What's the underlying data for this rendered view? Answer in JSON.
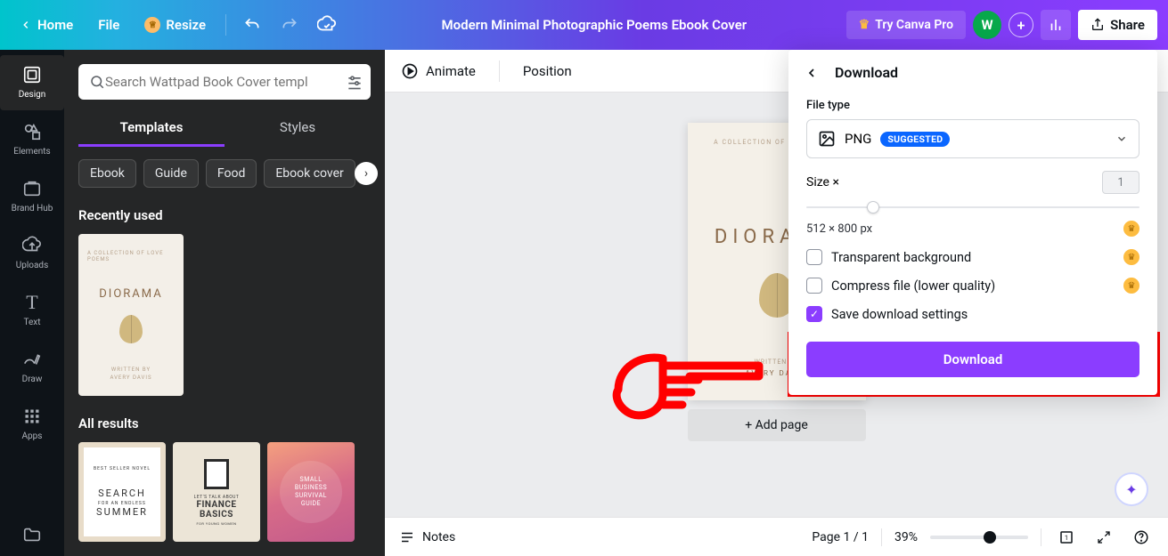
{
  "topbar": {
    "home": "Home",
    "file": "File",
    "resize": "Resize",
    "title": "Modern Minimal Photographic Poems Ebook Cover",
    "try_pro": "Try Canva Pro",
    "avatar_letter": "W",
    "share": "Share"
  },
  "rail": {
    "design": "Design",
    "elements": "Elements",
    "brandhub": "Brand Hub",
    "uploads": "Uploads",
    "text": "Text",
    "draw": "Draw",
    "apps": "Apps"
  },
  "panel": {
    "search_placeholder": "Search Wattpad Book Cover templ",
    "tab_templates": "Templates",
    "tab_styles": "Styles",
    "chips": {
      "ebook": "Ebook",
      "guide": "Guide",
      "food": "Food",
      "ebook_cover": "Ebook cover"
    },
    "recently_used": "Recently used",
    "all_results": "All results",
    "template1": {
      "top": "A COLLECTION OF LOVE POEMS",
      "title": "DIORAMA",
      "written": "WRITTEN BY",
      "author": "AVERY DAVIS"
    },
    "template_sm1": {
      "l1": "BEST SELLER NOVEL",
      "l2": "SEARCH",
      "l3": "FOR AN ENDLESS",
      "l4": "SUMMER"
    },
    "template_sm2": {
      "l1": "LET'S TALK ABOUT",
      "l2": "FINANCE",
      "l3": "BASICS",
      "l4": "FOR YOUNG WOMEN"
    },
    "template_sm3": {
      "l1": "SMALL",
      "l2": "BUSINESS",
      "l3": "SURVIVAL",
      "l4": "GUIDE"
    }
  },
  "editor": {
    "animate": "Animate",
    "position": "Position",
    "page_top": "A COLLECTION OF LOVE POEMS",
    "page_title": "DIORAMA",
    "page_written": "WRITTEN BY",
    "page_author": "AVERY DAVIS",
    "add_page": "+ Add page"
  },
  "popover": {
    "title": "Download",
    "file_type_label": "File type",
    "file_type_value": "PNG",
    "suggested": "SUGGESTED",
    "size_label": "Size ×",
    "size_value": "1",
    "dims": "512 × 800 px",
    "transparent": "Transparent background",
    "compress": "Compress file (lower quality)",
    "save_settings": "Save download settings",
    "download_btn": "Download"
  },
  "bottom": {
    "notes": "Notes",
    "page_counter": "Page 1 / 1",
    "zoom": "39%"
  }
}
